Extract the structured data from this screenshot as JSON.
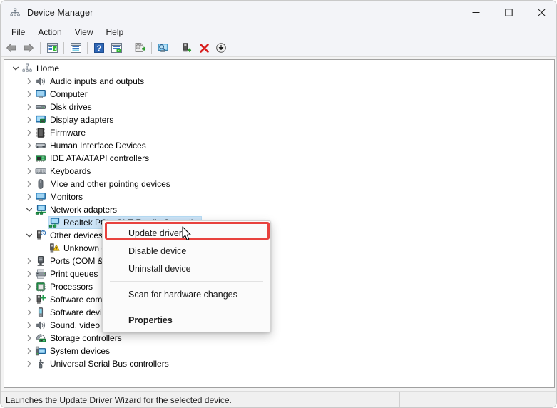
{
  "window": {
    "title": "Device Manager",
    "icon": "device-manager-icon",
    "controls": [
      {
        "name": "minimize-button",
        "glyph": "minimize"
      },
      {
        "name": "maximize-button",
        "glyph": "maximize"
      },
      {
        "name": "close-button",
        "glyph": "close"
      }
    ]
  },
  "menubar": {
    "items": [
      {
        "label": "File"
      },
      {
        "label": "Action"
      },
      {
        "label": "View"
      },
      {
        "label": "Help"
      }
    ]
  },
  "toolbar": {
    "buttons": [
      {
        "name": "back-icon",
        "icon": "back-arrow"
      },
      {
        "name": "forward-icon",
        "icon": "forward-arrow"
      },
      {
        "name": "separator-1",
        "icon": "separator"
      },
      {
        "name": "show-hide-console-tree-icon",
        "icon": "console-tree"
      },
      {
        "name": "separator-2",
        "icon": "separator"
      },
      {
        "name": "properties-icon",
        "icon": "properties-window"
      },
      {
        "name": "separator-3",
        "icon": "separator"
      },
      {
        "name": "help-icon",
        "icon": "question-mark"
      },
      {
        "name": "show-hide-action-pane-icon",
        "icon": "action-pane"
      },
      {
        "name": "separator-4",
        "icon": "separator"
      },
      {
        "name": "update-driver-icon",
        "icon": "update-driver"
      },
      {
        "name": "separator-5",
        "icon": "separator"
      },
      {
        "name": "scan-for-hardware-changes-icon",
        "icon": "scan-hardware"
      },
      {
        "name": "separator-6",
        "icon": "separator"
      },
      {
        "name": "enable-device-icon",
        "icon": "enable-device"
      },
      {
        "name": "uninstall-device-icon",
        "icon": "red-x"
      },
      {
        "name": "download-icon",
        "icon": "download-circle"
      }
    ]
  },
  "tree": {
    "rows": [
      {
        "label": "Home",
        "indent": 0,
        "expander": "expanded",
        "icon": "computer-home-icon",
        "selected": false
      },
      {
        "label": "Audio inputs and outputs",
        "indent": 1,
        "expander": "collapsed",
        "icon": "speaker-icon",
        "selected": false
      },
      {
        "label": "Computer",
        "indent": 1,
        "expander": "collapsed",
        "icon": "monitor-icon",
        "selected": false
      },
      {
        "label": "Disk drives",
        "indent": 1,
        "expander": "collapsed",
        "icon": "disk-drive-icon",
        "selected": false
      },
      {
        "label": "Display adapters",
        "indent": 1,
        "expander": "collapsed",
        "icon": "display-adapter-icon",
        "selected": false
      },
      {
        "label": "Firmware",
        "indent": 1,
        "expander": "collapsed",
        "icon": "firmware-chip-icon",
        "selected": false
      },
      {
        "label": "Human Interface Devices",
        "indent": 1,
        "expander": "collapsed",
        "icon": "gamepad-icon",
        "selected": false
      },
      {
        "label": "IDE ATA/ATAPI controllers",
        "indent": 1,
        "expander": "collapsed",
        "icon": "ide-controller-icon",
        "selected": false
      },
      {
        "label": "Keyboards",
        "indent": 1,
        "expander": "collapsed",
        "icon": "keyboard-icon",
        "selected": false
      },
      {
        "label": "Mice and other pointing devices",
        "indent": 1,
        "expander": "collapsed",
        "icon": "mouse-icon",
        "selected": false
      },
      {
        "label": "Monitors",
        "indent": 1,
        "expander": "collapsed",
        "icon": "monitor-icon",
        "selected": false
      },
      {
        "label": "Network adapters",
        "indent": 1,
        "expander": "expanded",
        "icon": "network-adapter-icon",
        "selected": false
      },
      {
        "label": "Realtek PCIe GbE Family Controller",
        "indent": 2,
        "expander": "none",
        "icon": "network-adapter-icon",
        "selected": true
      },
      {
        "label": "Other devices",
        "indent": 1,
        "expander": "expanded",
        "icon": "other-device-icon",
        "selected": false
      },
      {
        "label": "Unknown device",
        "indent": 2,
        "expander": "none",
        "icon": "unknown-device-warning-icon",
        "selected": false
      },
      {
        "label": "Ports (COM & LPT)",
        "indent": 1,
        "expander": "collapsed",
        "icon": "port-icon",
        "selected": false
      },
      {
        "label": "Print queues",
        "indent": 1,
        "expander": "collapsed",
        "icon": "printer-icon",
        "selected": false
      },
      {
        "label": "Processors",
        "indent": 1,
        "expander": "collapsed",
        "icon": "processor-icon",
        "selected": false
      },
      {
        "label": "Software components",
        "indent": 1,
        "expander": "collapsed",
        "icon": "software-component-icon",
        "selected": false
      },
      {
        "label": "Software devices",
        "indent": 1,
        "expander": "collapsed",
        "icon": "software-device-icon",
        "selected": false
      },
      {
        "label": "Sound, video and game controllers",
        "indent": 1,
        "expander": "collapsed",
        "icon": "speaker-icon",
        "selected": false
      },
      {
        "label": "Storage controllers",
        "indent": 1,
        "expander": "collapsed",
        "icon": "storage-controller-icon",
        "selected": false
      },
      {
        "label": "System devices",
        "indent": 1,
        "expander": "collapsed",
        "icon": "system-device-icon",
        "selected": false
      },
      {
        "label": "Universal Serial Bus controllers",
        "indent": 1,
        "expander": "collapsed",
        "icon": "usb-icon",
        "selected": false
      }
    ]
  },
  "context_menu": {
    "items": [
      {
        "label": "Update driver",
        "type": "item",
        "bold": false,
        "highlighted": true
      },
      {
        "label": "Disable device",
        "type": "item",
        "bold": false,
        "highlighted": false
      },
      {
        "label": "Uninstall device",
        "type": "item",
        "bold": false,
        "highlighted": false
      },
      {
        "label": "",
        "type": "separator",
        "bold": false,
        "highlighted": false
      },
      {
        "label": "Scan for hardware changes",
        "type": "item",
        "bold": false,
        "highlighted": false
      },
      {
        "label": "",
        "type": "separator",
        "bold": false,
        "highlighted": false
      },
      {
        "label": "Properties",
        "type": "item",
        "bold": true,
        "highlighted": false
      }
    ]
  },
  "statusbar": {
    "message": "Launches the Update Driver Wizard for the selected device."
  },
  "colors": {
    "selection": "#cce4f7",
    "annotation_red": "#e8423e",
    "titlebar": "#f3f4f8",
    "statusbar": "#f0f0f0"
  }
}
